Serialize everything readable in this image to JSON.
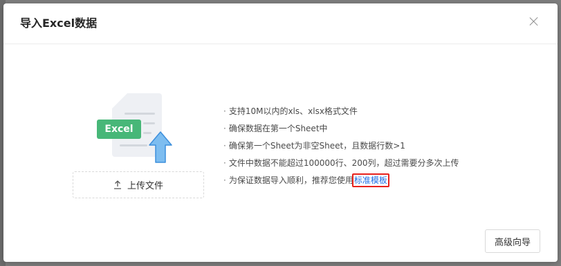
{
  "modal": {
    "title": "导入Excel数据",
    "close_icon": "close-icon"
  },
  "illustration": {
    "badge_text": "Excel",
    "badge_color": "#47b778",
    "arrow_color": "#5da6e8"
  },
  "upload": {
    "label": "上传文件",
    "icon": "upload-icon"
  },
  "tips": [
    "支持10M以内的xls、xlsx格式文件",
    "确保数据在第一个Sheet中",
    "确保第一个Sheet为非空Sheet，且数据行数>1",
    "文件中数据不能超过100000行、200列，超过需要分多次上传"
  ],
  "template_tip": {
    "prefix": "为保证数据导入顺利，推荐您使用",
    "link": "标准模板"
  },
  "footer": {
    "advanced_button": "高级向导"
  },
  "colors": {
    "link": "#1f6fe5",
    "highlight_box": "#e8221c"
  }
}
